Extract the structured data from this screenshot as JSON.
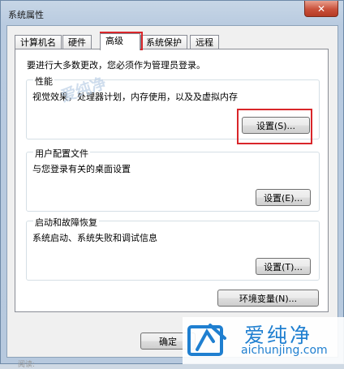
{
  "window": {
    "title": "系统属性",
    "close_symbol": "✕"
  },
  "tabs": [
    {
      "label": "计算机名",
      "active": false
    },
    {
      "label": "硬件",
      "active": false
    },
    {
      "label": "高级",
      "active": true
    },
    {
      "label": "系统保护",
      "active": false
    },
    {
      "label": "远程",
      "active": false
    }
  ],
  "panel": {
    "intro": "要进行大多数更改，您必须作为管理员登录。",
    "performance": {
      "title": "性能",
      "description": "视觉效果，处理器计划，内存使用，以及及虚拟内存",
      "button": "设置(S)..."
    },
    "user_profiles": {
      "title": "用户配置文件",
      "description": "与您登录有关的桌面设置",
      "button": "设置(E)..."
    },
    "startup_recovery": {
      "title": "启动和故障恢复",
      "description": "系统启动、系统失败和调试信息",
      "button": "设置(T)..."
    },
    "env_button": "环境变量(N)..."
  },
  "footer": {
    "ok_button": "确定"
  },
  "watermark": {
    "text": "爱纯净",
    "overlay_text": "爱纯净",
    "url": "aichunjing.com",
    "accent_color": "#1f7fd0"
  },
  "bottom_text": "阅读:"
}
